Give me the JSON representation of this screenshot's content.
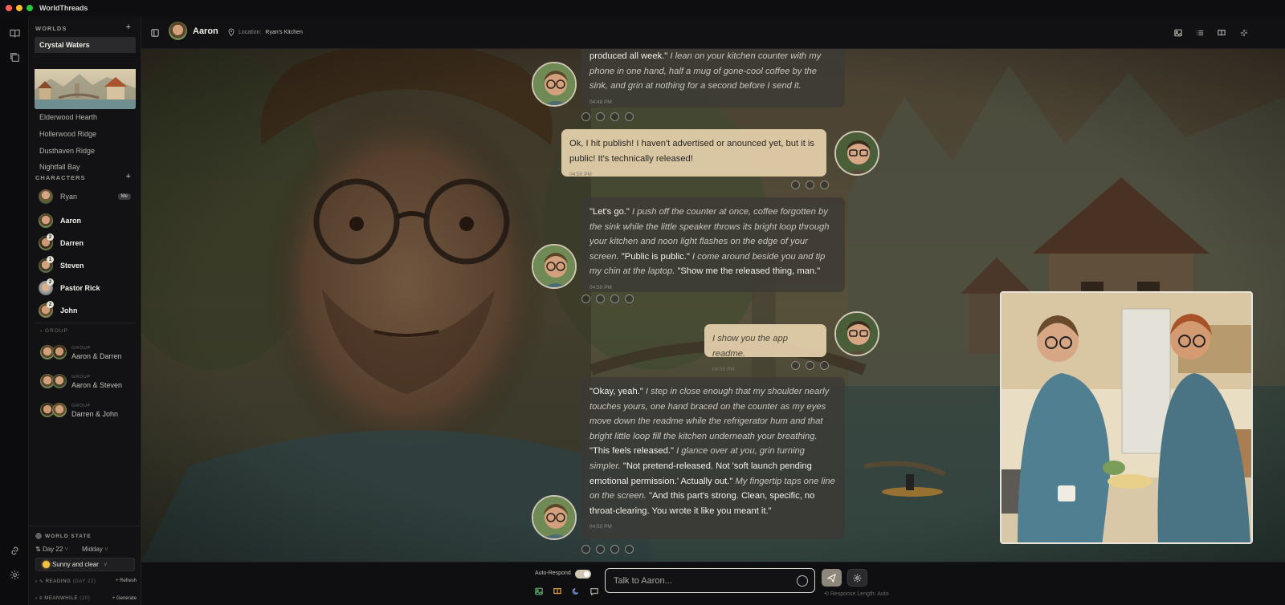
{
  "app": {
    "title": "WorldThreads"
  },
  "sidebar": {
    "worlds_heading": "WORLDS",
    "worlds": [
      {
        "label": "Crystal Waters",
        "active": true
      },
      {
        "label": "Elderwood Hearth"
      },
      {
        "label": "Hollerwood Ridge"
      },
      {
        "label": "Dusthaven Ridge"
      },
      {
        "label": "Nightfall Bay"
      }
    ],
    "characters_heading": "CHARACTERS",
    "characters": [
      {
        "name": "Ryan",
        "tag": "Me"
      },
      {
        "name": "Aaron"
      },
      {
        "name": "Darren",
        "badge": "2"
      },
      {
        "name": "Steven",
        "badge": "1"
      },
      {
        "name": "Pastor Rick",
        "badge": "2"
      },
      {
        "name": "John",
        "badge": "2"
      }
    ],
    "group_heading": "GROUP",
    "groups": [
      {
        "small": "GROUP",
        "name": "Aaron & Darren"
      },
      {
        "small": "GROUP",
        "name": "Aaron & Steven"
      },
      {
        "small": "GROUP",
        "name": "Darren & John"
      }
    ],
    "world_state": {
      "title": "WORLD STATE",
      "day": "Day 22",
      "time": "Midday",
      "weather": "Sunny and clear",
      "reading_label": "READING",
      "reading_meta": "(DAY 22)",
      "reading_action": "Refresh",
      "meanwhile_label": "MEANWHILE",
      "meanwhile_meta": "(20)",
      "meanwhile_action": "Generate"
    }
  },
  "header": {
    "name": "Aaron",
    "location_label": "Location:",
    "location": "Ryan's Kitchen"
  },
  "messages": [
    {
      "role": "ai",
      "parts": [
        {
          "t": "produced all week.\" ",
          "i": false
        },
        {
          "t": "I lean on your kitchen counter with my phone in one hand, half a mug of gone-cool coffee by the sink, and grin at nothing for a second before I send it.",
          "i": true
        }
      ],
      "time": "04:48 PM"
    },
    {
      "role": "user",
      "parts": [
        {
          "t": "Ok, I hit publish! I haven't advertised or anounced yet, but it is public! It's technically released!",
          "i": false
        }
      ],
      "time": "04:50 PM"
    },
    {
      "role": "ai",
      "parts": [
        {
          "t": "\"Let's go.\" ",
          "i": false
        },
        {
          "t": "I push off the counter at once, coffee forgotten by the sink while the little speaker throws its bright loop through your kitchen and noon light flashes on the edge of your screen. ",
          "i": true
        },
        {
          "t": "\"Public is public.\" ",
          "i": false
        },
        {
          "t": "I come around beside you and tip my chin at the laptop. ",
          "i": true
        },
        {
          "t": "\"Show me the released thing, man.\"",
          "i": false
        }
      ],
      "time": "04:50 PM"
    },
    {
      "role": "user",
      "parts": [
        {
          "t": "I show you the app readme.",
          "i": true
        }
      ],
      "time": "04:50 PM"
    },
    {
      "role": "ai",
      "parts": [
        {
          "t": "\"Okay, yeah.\" ",
          "i": false
        },
        {
          "t": "I step in close enough that my shoulder nearly touches yours, one hand braced on the counter as my eyes move down the readme while the refrigerator hum and that bright little loop fill the kitchen underneath your breathing. ",
          "i": true
        },
        {
          "t": "\"This feels released.\" ",
          "i": false
        },
        {
          "t": "I glance over at you, grin turning simpler. ",
          "i": true
        },
        {
          "t": "\"Not pretend-released. Not 'soft launch pending emotional permission.' Actually out.\" ",
          "i": false
        },
        {
          "t": "My fingertip taps one line on the screen. ",
          "i": true
        },
        {
          "t": "\"And this part's strong. Clean, specific, no throat-clearing. You wrote it like you meant it.\"",
          "i": false
        }
      ],
      "time": "04:50 PM"
    }
  ],
  "footer": {
    "auto_respond_label": "Auto-Respond",
    "auto_respond_on": true,
    "input_placeholder": "Talk to Aaron...",
    "response_length": "Response Length: Auto"
  },
  "colors": {
    "accent": "#cfc7b2",
    "user_bubble": "#e2ceaa",
    "ai_bubble": "#3c3a36"
  },
  "icons": [
    "book-icon",
    "frames-icon",
    "link-icon",
    "gear-icon",
    "plus-icon",
    "sidebar-toggle-icon",
    "pin-icon",
    "image-icon",
    "list-icon",
    "open-book-icon",
    "sparkle-icon",
    "send-icon",
    "smiley-icon",
    "moon-icon",
    "chat-icon",
    "sun-icon",
    "globe-icon",
    "calendar-icon",
    "chevron-icon"
  ]
}
